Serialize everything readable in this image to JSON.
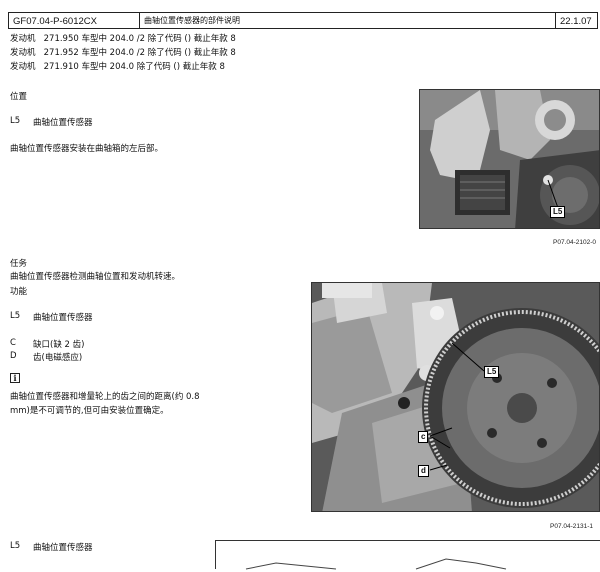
{
  "header": {
    "doc_code": "GF07.04-P-6012CX",
    "title": "曲轴位置传感器的部件说明",
    "date": "22.1.07"
  },
  "engine_lines": [
    {
      "label": "发动机",
      "text": "271.950 车型中 204.0 /2 除了代码 () 截止年款 8"
    },
    {
      "label": "发动机",
      "text": "271.952 车型中 204.0 /2 除了代码 () 截止年款 8"
    },
    {
      "label": "发动机",
      "text": "271.910 车型中 204.0 除了代码 () 截止年款 8"
    }
  ],
  "location": {
    "heading": "位置",
    "item_code": "L5",
    "item_name": "曲轴位置传感器",
    "description": "曲轴位置传感器安装在曲轴箱的左后部。"
  },
  "task": {
    "heading": "任务",
    "description": "曲轴位置传感器检测曲轴位置和发动机转速。"
  },
  "function": {
    "heading": "功能",
    "item_code": "L5",
    "item_name": "曲轴位置传感器",
    "legend": [
      {
        "code": "C",
        "text": "缺口(缺 2 齿)"
      },
      {
        "code": "D",
        "text": "齿(电磁感应)"
      }
    ],
    "info_symbol": "i",
    "note_line1": "曲轴位置传感器和增量轮上的齿之间的距离(约 0.8",
    "note_line2": "mm)是不可调节的,但可由安装位置确定。"
  },
  "figures": {
    "fig1_caption": "P07.04-2102-0",
    "fig1_callout": "L5",
    "fig2_caption": "P07.04-2131-1",
    "fig2_callout_l5": "L5",
    "fig2_callout_c": "c",
    "fig2_callout_d": "d"
  },
  "bottom": {
    "item_code": "L5",
    "item_name": "曲轴位置传感器"
  }
}
